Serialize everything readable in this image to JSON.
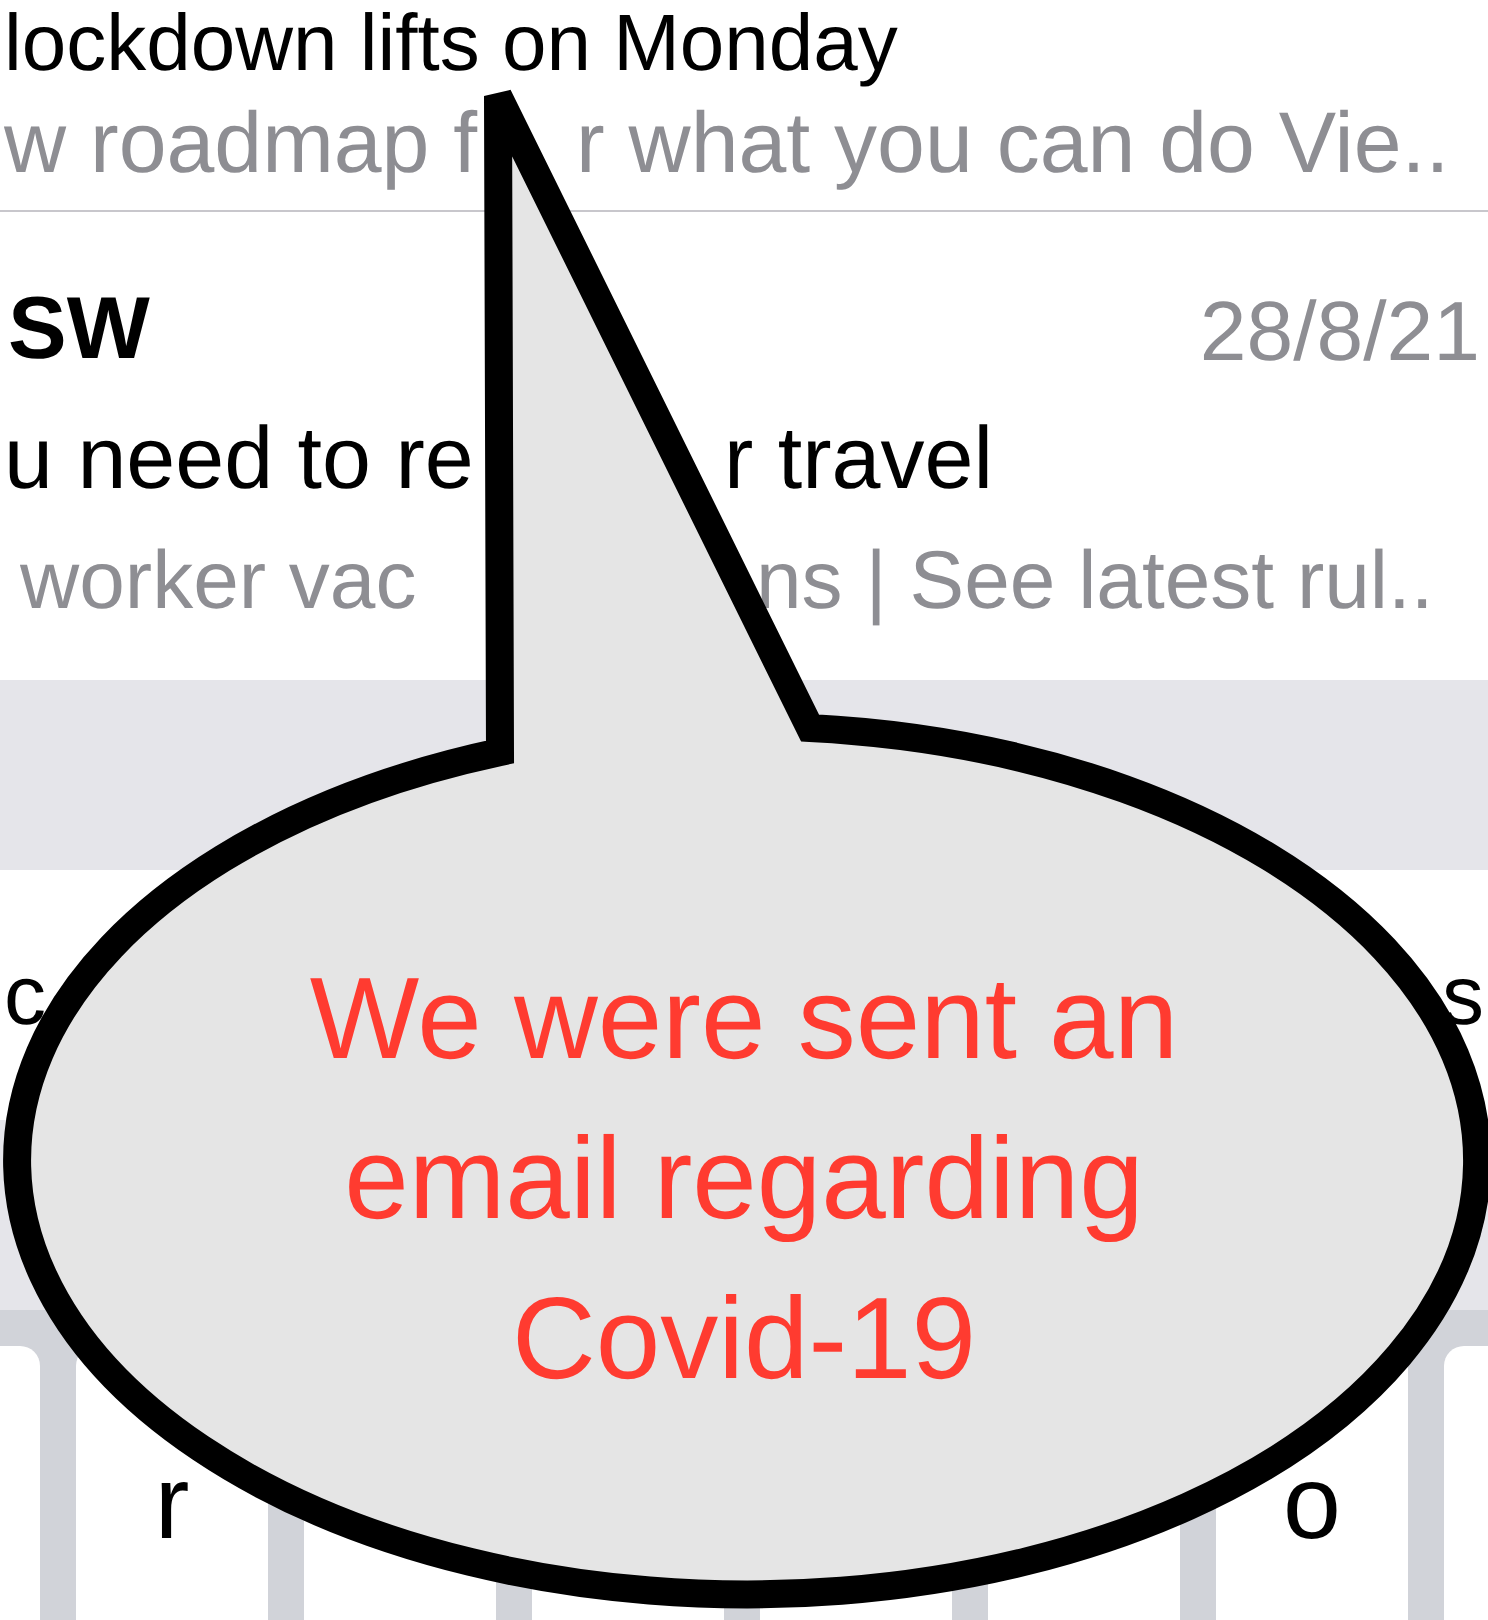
{
  "messages": [
    {
      "subject": [
        "lockdown lifts on Monday"
      ],
      "preview": [
        "w roadmap f",
        "r what you can do Vie.."
      ]
    },
    {
      "sender": "SW",
      "date": "28/8/21",
      "subject": [
        "u need to re",
        "r travel"
      ],
      "preview": [
        "worker vac",
        "ns | See latest rul.."
      ]
    }
  ],
  "bar_texts": [
    "c",
    "s"
  ],
  "keyboard": {
    "keys": [
      "r",
      "o"
    ]
  },
  "callout": {
    "text": "We were sent an email regarding Covid-19"
  }
}
